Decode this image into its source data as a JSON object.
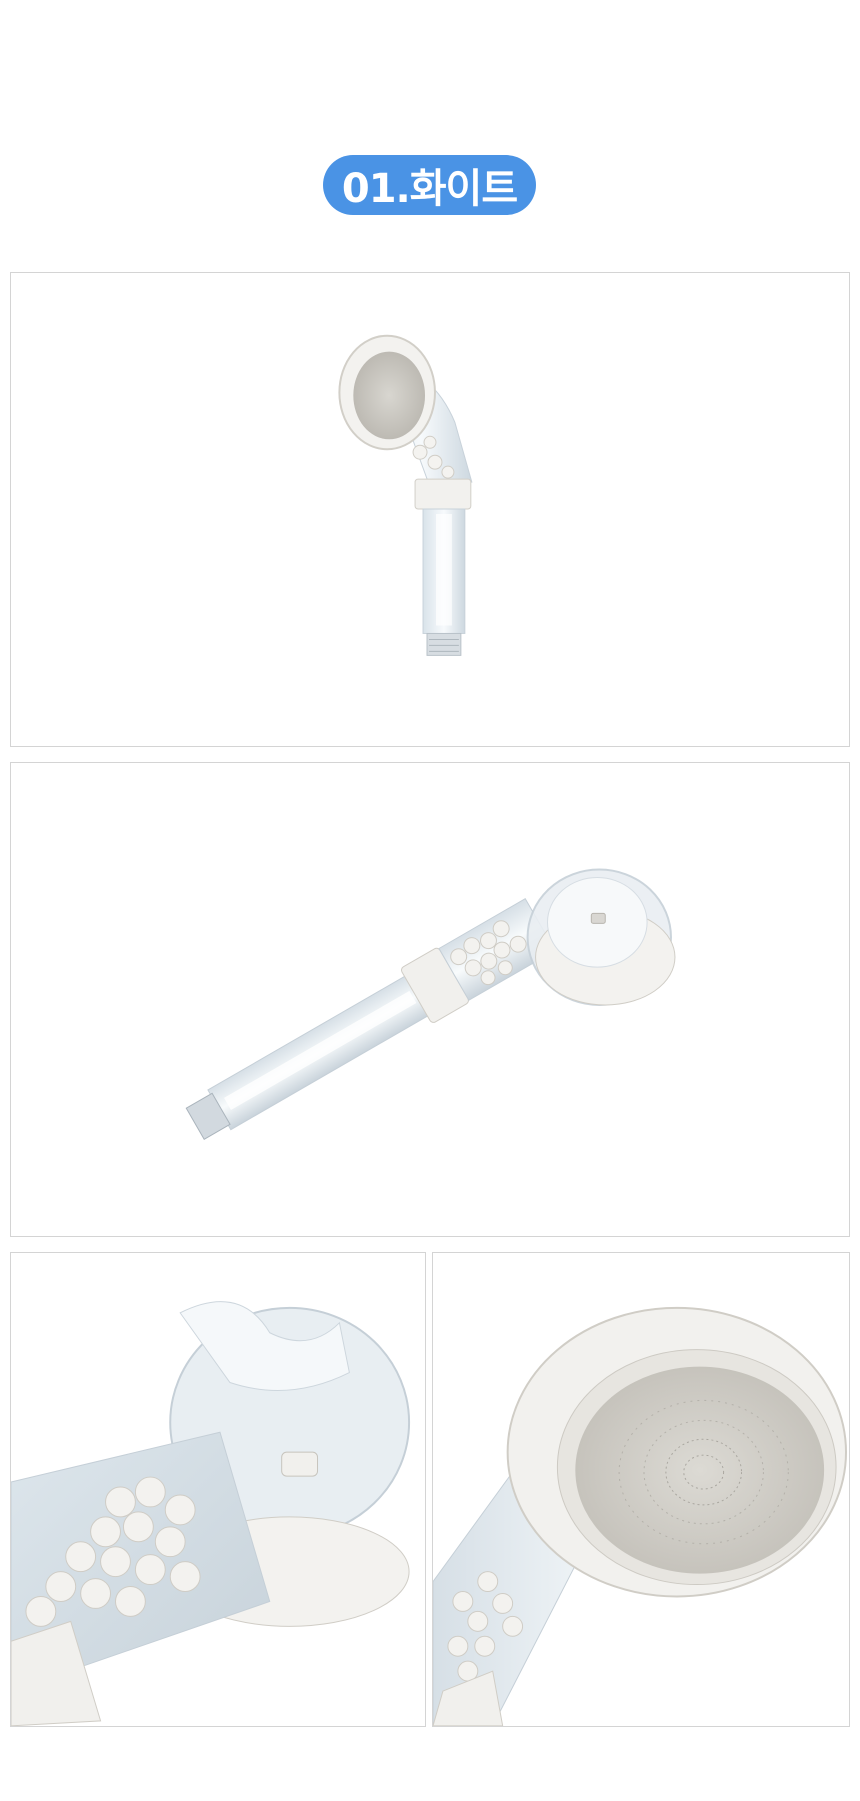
{
  "color_badge": {
    "label": "01.화이트",
    "background": "#4a93e5",
    "text_color": "#ffffff"
  },
  "photos": [
    {
      "subject": "showerhead-front-view-icon"
    },
    {
      "subject": "showerhead-angled-view-icon"
    },
    {
      "subject": "filter-beads-closeup-icon"
    },
    {
      "subject": "spray-face-closeup-icon"
    }
  ],
  "colors": {
    "frame_border": "#d4d4d4",
    "product_white": "#f2f1ee",
    "product_clear": "#e6eef3"
  }
}
